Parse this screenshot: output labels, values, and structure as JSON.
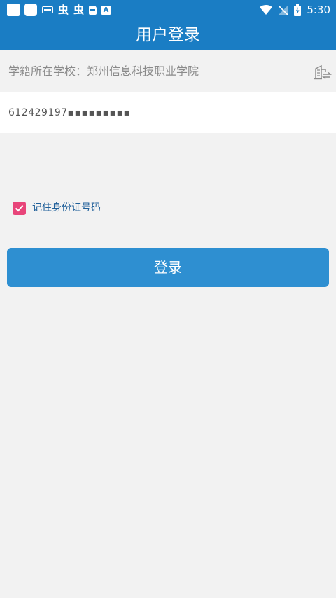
{
  "status_bar": {
    "time": "5:30",
    "colors": {
      "background": "#1a7dc4"
    },
    "left_icons": [
      "app-square-icon",
      "app-rounded-icon",
      "keyboard-icon",
      "bug-icon",
      "bug-icon",
      "sd-card-icon",
      "font-a-icon"
    ],
    "right_icons": [
      "wifi-icon",
      "no-signal-icon",
      "battery-charging-icon"
    ]
  },
  "app_bar": {
    "title": "用户登录",
    "color": "#1a7dc4"
  },
  "form": {
    "school": {
      "label": "学籍所在学校：",
      "value": "郑州信息科技职业学院",
      "icon": "school-switch-icon"
    },
    "id_number": {
      "value": "612429197▪▪▪▪▪▪▪▪▪"
    },
    "remember": {
      "label": "记住身份证号码",
      "checked": true,
      "color": "#e8457a"
    },
    "login_button": {
      "label": "登录",
      "color": "#2e8fd1"
    }
  }
}
